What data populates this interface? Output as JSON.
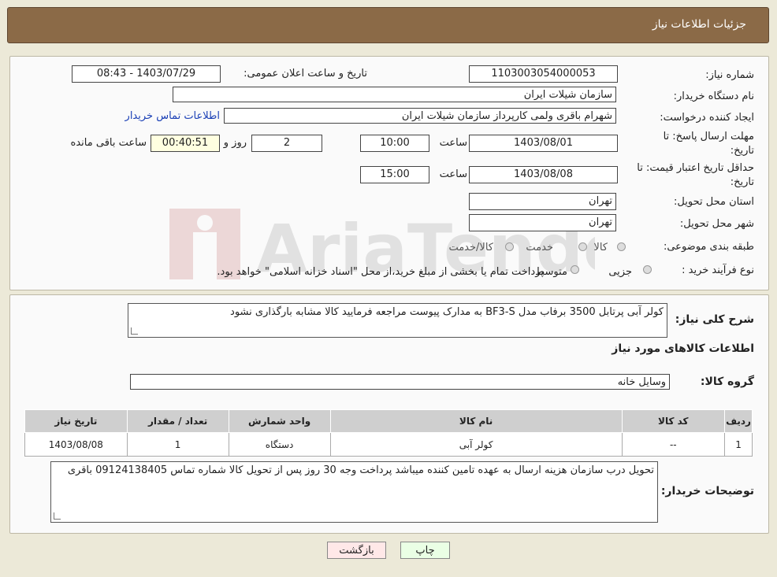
{
  "header": {
    "title": "جزئیات اطلاعات نیاز"
  },
  "form": {
    "need_number_label": "شماره نیاز:",
    "need_number": "1103003054000053",
    "announce_label": "تاریخ و ساعت اعلان عمومی:",
    "announce_value": "1403/07/29 - 08:43",
    "buyer_org_label": "نام دستگاه خریدار:",
    "buyer_org": "سازمان شیلات ایران",
    "requester_label": "ایجاد کننده درخواست:",
    "requester": "شهرام باقری ولمی کارپرداز سازمان شیلات ایران",
    "contact_link": "اطلاعات تماس خریدار",
    "reply_deadline_label_1": "مهلت ارسال پاسخ: تا",
    "reply_deadline_label_2": "تاریخ:",
    "reply_date": "1403/08/01",
    "time_label": "ساعت",
    "reply_time": "10:00",
    "days": "2",
    "days_label": "روز و",
    "remaining": "00:40:51",
    "remaining_label": "ساعت باقی مانده",
    "price_validity_label_1": "حداقل تاریخ اعتبار قیمت: تا",
    "price_validity_label_2": "تاریخ:",
    "price_date": "1403/08/08",
    "price_time": "15:00",
    "province_label": "استان محل تحویل:",
    "province": "تهران",
    "city_label": "شهر محل تحویل:",
    "city": "تهران",
    "category_label": "طبقه بندی موضوعی:",
    "category_options": [
      "کالا",
      "خدمت",
      "کالا/خدمت"
    ],
    "process_label": "نوع فرآیند خرید :",
    "process_options": [
      "جزیی",
      "متوسط"
    ],
    "process_note": "پرداخت تمام یا بخشی از مبلغ خرید،از محل \"اسناد خزانه اسلامی\" خواهد بود."
  },
  "details": {
    "summary_label": "شرح کلی نیاز:",
    "summary": "کولر آبی پرتابل 3500 برفاب مدل BF3-S به مدارک پیوست مراجعه فرمایید کالا مشابه بارگذاری نشود",
    "goods_info_title": "اطلاعات کالاهای مورد نیاز",
    "goods_group_label": "گروه کالا:",
    "goods_group": "وسایل خانه",
    "table": {
      "headers": [
        "ردیف",
        "کد کالا",
        "نام کالا",
        "واحد شمارش",
        "تعداد / مقدار",
        "تاریخ نیاز"
      ],
      "rows": [
        [
          "1",
          "--",
          "کولر آبی",
          "دستگاه",
          "1",
          "1403/08/08"
        ]
      ]
    },
    "buyer_notes_label": "توضیحات خریدار:",
    "buyer_notes": "تحویل درب سازمان هزینه ارسال به عهده تامین کننده میباشد پرداخت وجه 30 روز پس از تحویل کالا شماره تماس 09124138405 باقری"
  },
  "buttons": {
    "print": "چاپ",
    "back": "بازگشت"
  },
  "colors": {
    "titlebar": "#8b6a47",
    "link": "#1a3fb5",
    "print_bg": "#eaffe5",
    "back_bg": "#ffe8e8"
  },
  "watermark_text": "AriaTender.net"
}
